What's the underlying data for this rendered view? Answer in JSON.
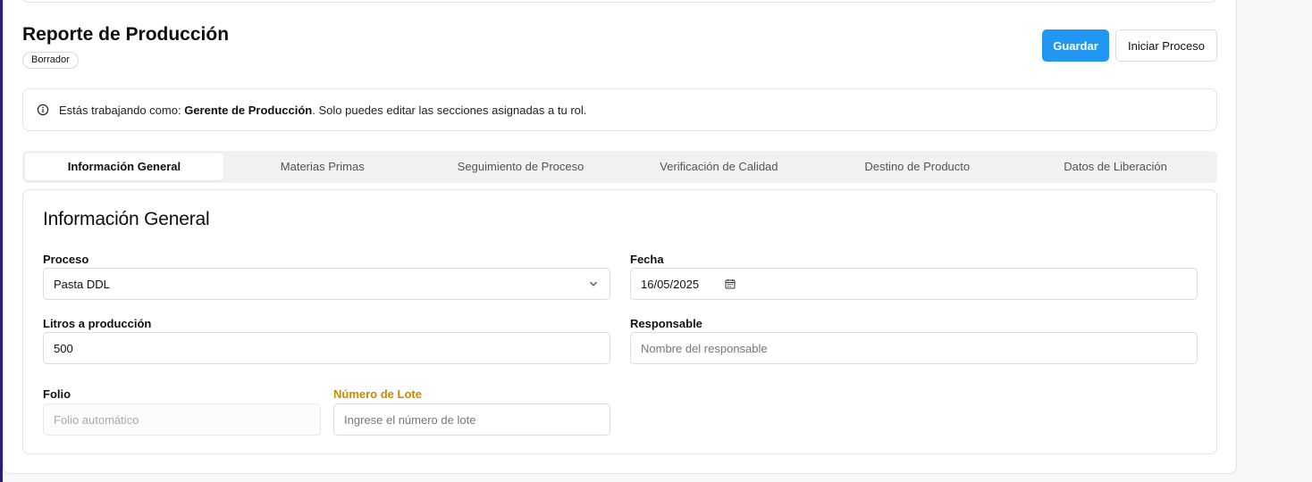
{
  "header": {
    "title": "Reporte de Producción",
    "status": "Borrador",
    "save_label": "Guardar",
    "start_label": "Iniciar Proceso"
  },
  "alert": {
    "prefix": "Estás trabajando como: ",
    "role": "Gerente de Producción",
    "suffix": ". Solo puedes editar las secciones asignadas a tu rol."
  },
  "tabs": [
    {
      "label": "Información General",
      "active": true
    },
    {
      "label": "Materias Primas",
      "active": false
    },
    {
      "label": "Seguimiento de Proceso",
      "active": false
    },
    {
      "label": "Verificación de Calidad",
      "active": false
    },
    {
      "label": "Destino de Producto",
      "active": false
    },
    {
      "label": "Datos de Liberación",
      "active": false
    }
  ],
  "form": {
    "title": "Información General",
    "proceso": {
      "label": "Proceso",
      "value": "Pasta DDL"
    },
    "fecha": {
      "label": "Fecha",
      "value": "16/05/2025"
    },
    "litros": {
      "label": "Litros a producción",
      "value": "500"
    },
    "responsable": {
      "label": "Responsable",
      "placeholder": "Nombre del responsable"
    },
    "folio": {
      "label": "Folio",
      "placeholder": "Folio automático"
    },
    "lote": {
      "label": "Número de Lote",
      "placeholder": "Ingrese el número de lote"
    }
  },
  "colors": {
    "primary": "#2196f3",
    "warning_label": "#c98a00",
    "accent_bar": "#2b1e6e"
  }
}
